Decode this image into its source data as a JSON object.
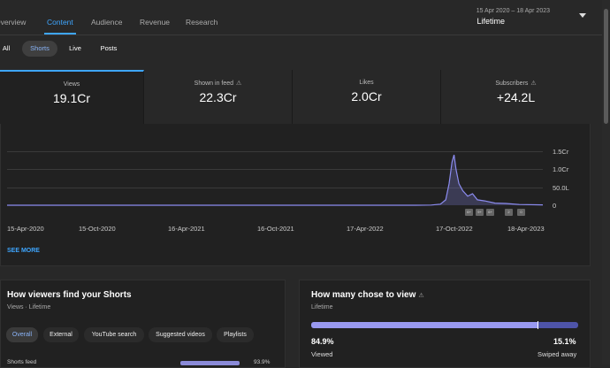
{
  "header": {
    "tabs": [
      {
        "label": "Overview"
      },
      {
        "label": "Content"
      },
      {
        "label": "Audience"
      },
      {
        "label": "Revenue"
      },
      {
        "label": "Research"
      }
    ],
    "date_range": "15 Apr 2020 – 18 Apr 2023",
    "period": "Lifetime"
  },
  "content_types": [
    "All",
    "Shorts",
    "Live",
    "Posts"
  ],
  "metrics": [
    {
      "label": "Views",
      "value": "19.1Cr",
      "warn": false
    },
    {
      "label": "Shown in feed",
      "value": "22.3Cr",
      "warn": true
    },
    {
      "label": "Likes",
      "value": "2.0Cr",
      "warn": false
    },
    {
      "label": "Subscribers",
      "value": "+24.2L",
      "warn": true
    }
  ],
  "chart_data": {
    "type": "line",
    "y_ticks": [
      "1.5Cr",
      "1.0Cr",
      "50.0L",
      "0"
    ],
    "x_ticks": [
      "15-Apr-2020",
      "15-Oct-2020",
      "16-Apr-2021",
      "16-Oct-2021",
      "17-Apr-2022",
      "17-Oct-2022",
      "18-Apr-2023"
    ],
    "ylim": [
      0,
      15000000
    ],
    "series": [
      {
        "color": "#8c8cf0",
        "points": [
          [
            "2020-04-15",
            0
          ],
          [
            "2022-08-01",
            0
          ],
          [
            "2022-09-01",
            50000
          ],
          [
            "2022-09-20",
            300000
          ],
          [
            "2022-10-01",
            1500000
          ],
          [
            "2022-10-08",
            6000000
          ],
          [
            "2022-10-14",
            12000000
          ],
          [
            "2022-10-18",
            14000000
          ],
          [
            "2022-10-22",
            10000000
          ],
          [
            "2022-10-28",
            6000000
          ],
          [
            "2022-11-05",
            4000000
          ],
          [
            "2022-11-15",
            2500000
          ],
          [
            "2022-11-25",
            3200000
          ],
          [
            "2022-12-05",
            1500000
          ],
          [
            "2022-12-20",
            1200000
          ],
          [
            "2023-01-10",
            600000
          ],
          [
            "2023-02-01",
            500000
          ],
          [
            "2023-03-01",
            200000
          ],
          [
            "2023-04-18",
            100000
          ]
        ]
      }
    ],
    "markers": [
      "6+",
      "9+",
      "6+",
      "2",
      "0"
    ]
  },
  "see_more": "SEE MORE",
  "find_shorts": {
    "title": "How viewers find your Shorts",
    "subtitle": "Views · Lifetime",
    "chips": [
      "Overall",
      "External",
      "YouTube search",
      "Suggested videos",
      "Playlists"
    ],
    "first_row_label": "Shorts feed",
    "first_row_value": "93.9%"
  },
  "chose_to_view": {
    "title": "How many chose to view",
    "subtitle": "Lifetime",
    "viewed_pct": 84.9,
    "viewed_value": "84.9%",
    "viewed_label": "Viewed",
    "swiped_value": "15.1%",
    "swiped_label": "Swiped away"
  },
  "colors": {
    "accent": "#3ea6ff",
    "line": "#8c8cf0",
    "bar": "#9999f0",
    "bar_rest": "#4e54a8"
  }
}
